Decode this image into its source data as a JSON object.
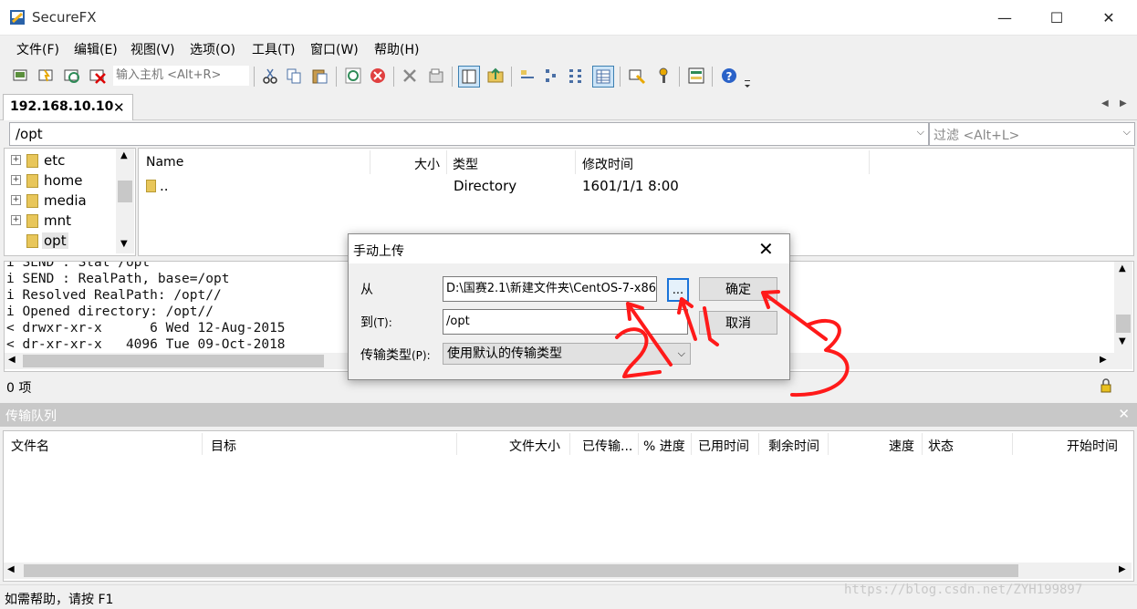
{
  "window": {
    "title": "SecureFX",
    "minimize_glyph": "—",
    "maximize_glyph": "☐",
    "close_glyph": "✕"
  },
  "menu": [
    "文件(F)",
    "编辑(E)",
    "视图(V)",
    "选项(O)",
    "工具(T)",
    "窗口(W)",
    "帮助(H)"
  ],
  "toolbar": {
    "host_placeholder": "输入主机 <Alt+R>",
    "icons": [
      "connect-icon",
      "quick-connect-icon",
      "reconnect-icon",
      "disconnect-icon",
      "cut-icon",
      "copy-icon",
      "paste-icon",
      "refresh-icon",
      "stop-icon",
      "delete-icon",
      "properties-icon",
      "view-pane-icon",
      "upload-folder-icon",
      "large-icons-icon",
      "small-icons-icon",
      "list-icon",
      "details-icon",
      "filter-icon",
      "key-icon",
      "queue-icon",
      "help-icon"
    ]
  },
  "tab": {
    "label": "192.168.10.10",
    "close_glyph": "✕"
  },
  "path": {
    "value": "/opt",
    "filter_placeholder": "过滤 <Alt+L>"
  },
  "tree": [
    {
      "label": "etc"
    },
    {
      "label": "home"
    },
    {
      "label": "media"
    },
    {
      "label": "mnt"
    },
    {
      "label": "opt"
    }
  ],
  "filelist": {
    "columns": [
      "Name",
      "大小",
      "类型",
      "修改时间"
    ],
    "rows": [
      {
        "name": "..",
        "size": "",
        "type": "Directory",
        "modified": "1601/1/1 8:00"
      }
    ]
  },
  "log": [
    "i SEND : Stat /opt",
    "i SEND : RealPath, base=/opt",
    "i Resolved RealPath: /opt//",
    "i Opened directory: /opt//",
    "< drwxr-xr-x      6 Wed 12-Aug-2015",
    "< dr-xr-xr-x   4096 Tue 09-Oct-2018"
  ],
  "items_count": "0 项",
  "queue": {
    "title": "传输队列",
    "columns": [
      "文件名",
      "目标",
      "文件大小",
      "已传输...",
      "% 进度",
      "已用时间",
      "剩余时间",
      "速度",
      "状态",
      "开始时间"
    ]
  },
  "status": "如需帮助，请按 F1",
  "watermark": "https://blog.csdn.net/ZYH199897",
  "dialog": {
    "title": "手动上传",
    "from_label": "从",
    "from_value": "D:\\国赛2.1\\新建文件夹\\CentOS-7-x86",
    "browse_label": "...",
    "to_label": "到",
    "to_hotkey": "(T):",
    "to_value": "/opt",
    "type_label": "传输类型",
    "type_hotkey": "(P):",
    "type_value": "使用默认的传输类型",
    "ok_label": "确定",
    "cancel_label": "取消"
  },
  "annotations": {
    "color": "#ff1a1a",
    "marks": [
      "1",
      "2",
      "3"
    ]
  }
}
